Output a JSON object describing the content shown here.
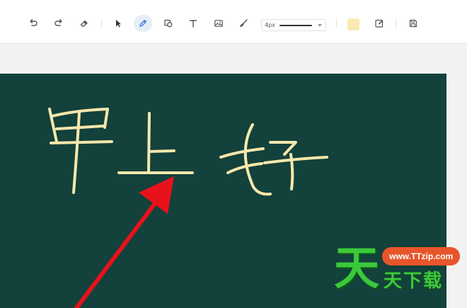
{
  "toolbar": {
    "tools": [
      {
        "name": "undo-icon",
        "active": false
      },
      {
        "name": "redo-icon",
        "active": false
      },
      {
        "name": "eraser-icon",
        "active": false
      },
      {
        "name": "cursor-select-icon",
        "active": false
      },
      {
        "name": "pen-icon",
        "active": true
      },
      {
        "name": "shape-icon",
        "active": false
      },
      {
        "name": "text-icon",
        "active": false
      },
      {
        "name": "image-icon",
        "active": false
      },
      {
        "name": "brush-icon",
        "active": false
      },
      {
        "name": "fill-color-swatch",
        "active": false
      },
      {
        "name": "edit-note-icon",
        "active": false
      },
      {
        "name": "save-icon",
        "active": false
      }
    ],
    "stroke_width_label": "4px",
    "colors": {
      "active_tool": "#3b78d8",
      "icon": "#555555",
      "fill_swatch": "#fbe9b2"
    }
  },
  "canvas": {
    "background": "#13413b",
    "ink_color": "#f6e7ad",
    "arrow_color": "#e8121b",
    "handwritten_text": "早上好"
  },
  "watermark": {
    "big_char": "天",
    "url": "www.TTzip.com",
    "small_text": "天下载",
    "colors": {
      "green": "#3cc83c",
      "pill": "#e8552a"
    }
  }
}
